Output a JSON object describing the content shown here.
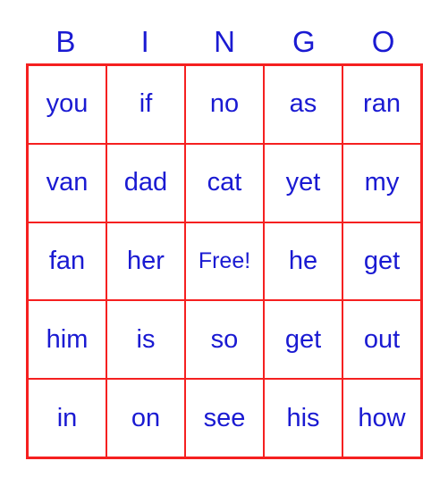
{
  "card": {
    "columns": [
      "B",
      "I",
      "N",
      "G",
      "O"
    ],
    "colors": {
      "border": "#f52020",
      "text": "#1a1ad2",
      "background": "#ffffff"
    },
    "rows": [
      [
        "you",
        "if",
        "no",
        "as",
        "ran"
      ],
      [
        "van",
        "dad",
        "cat",
        "yet",
        "my"
      ],
      [
        "fan",
        "her",
        "Free!",
        "he",
        "get"
      ],
      [
        "him",
        "is",
        "so",
        "get",
        "out"
      ],
      [
        "in",
        "on",
        "see",
        "his",
        "how"
      ]
    ]
  }
}
